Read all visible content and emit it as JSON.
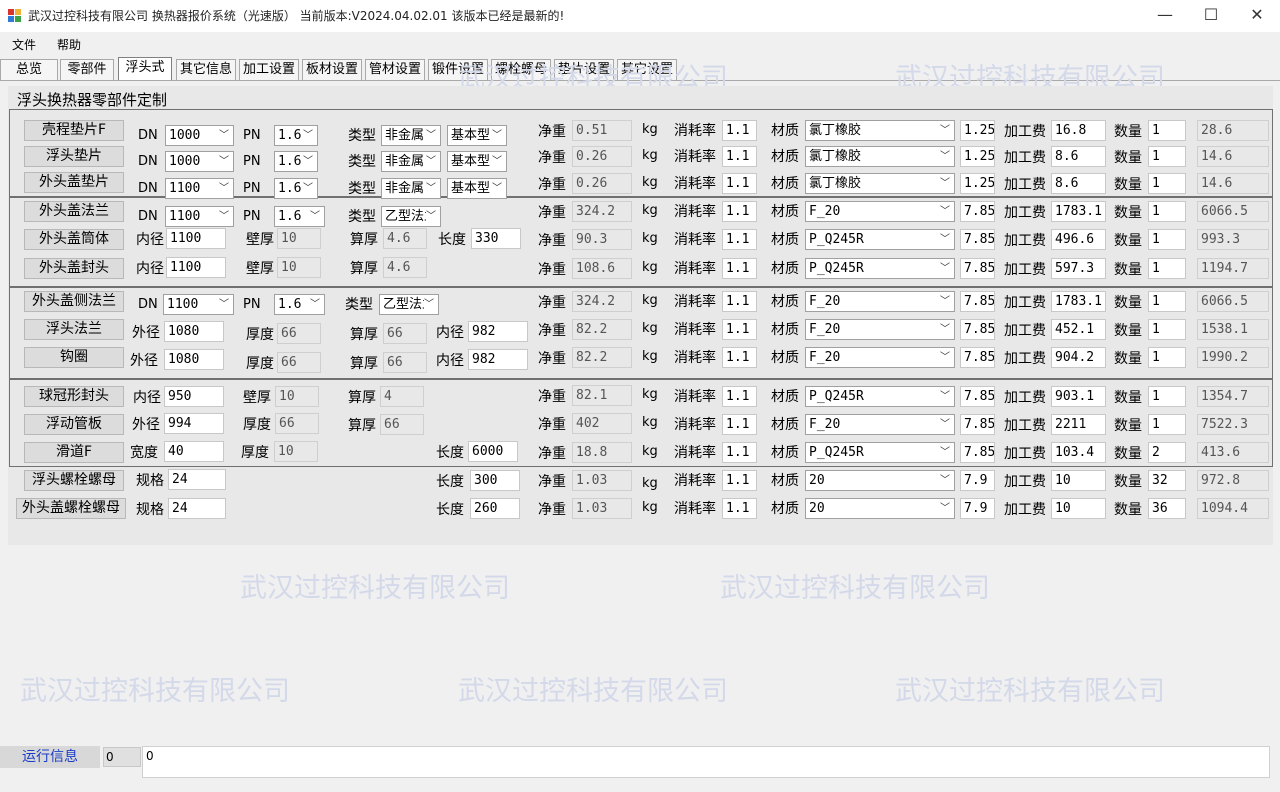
{
  "window": {
    "title": "武汉过控科技有限公司   换热器报价系统（光速版）  当前版本:V2024.04.02.01     该版本已经是最新的!",
    "minimize": "—",
    "maximize": "☐",
    "close": "✕"
  },
  "menu": {
    "file": "文件",
    "help": "帮助"
  },
  "tabs": [
    "总览",
    "零部件",
    "浮头式",
    "其它信息",
    "加工设置",
    "板材设置",
    "管材设置",
    "锻件设置",
    "螺栓螺母",
    "垫片设置",
    "其它设置"
  ],
  "panel": {
    "title": "浮头换热器零部件定制"
  },
  "labels": {
    "dn": "DN",
    "pn": "PN",
    "type": "类型",
    "net": "净重",
    "kg": "kg",
    "loss": "消耗率",
    "material": "材质",
    "fee": "加工费",
    "qty": "数量",
    "inner_d": "内径",
    "outer_d": "外径",
    "wall": "壁厚",
    "thick": "厚度",
    "calc_thick": "算厚",
    "length": "长度",
    "width": "宽度",
    "spec": "规格"
  },
  "watermark": "武汉过控科技有限公司",
  "rows": [
    {
      "name": "壳程垫片F",
      "dn": "1000",
      "pn": "1.6",
      "type1": "非金属",
      "type2": "基本型",
      "net": "0.51",
      "loss": "1.1",
      "mat": "氯丁橡胶",
      "den": "1.25",
      "fee": "16.8",
      "qty": "1",
      "total": "28.6"
    },
    {
      "name": "浮头垫片",
      "dn": "1000",
      "pn": "1.6",
      "type1": "非金属",
      "type2": "基本型",
      "net": "0.26",
      "loss": "1.1",
      "mat": "氯丁橡胶",
      "den": "1.25",
      "fee": "8.6",
      "qty": "1",
      "total": "14.6"
    },
    {
      "name": "外头盖垫片",
      "dn": "1100",
      "pn": "1.6",
      "type1": "非金属",
      "type2": "基本型",
      "net": "0.26",
      "loss": "1.1",
      "mat": "氯丁橡胶",
      "den": "1.25",
      "fee": "8.6",
      "qty": "1",
      "total": "14.6"
    },
    {
      "name": "外头盖法兰",
      "dn": "1100",
      "pn": "1.6",
      "type1": "乙型法兰",
      "net": "324.2",
      "loss": "1.1",
      "mat": "F_20",
      "den": "7.85",
      "fee": "1783.1",
      "qty": "1",
      "total": "6066.5"
    },
    {
      "name": "外头盖筒体",
      "inner": "1100",
      "wall": "10",
      "calc": "4.6",
      "length": "330",
      "net": "90.3",
      "loss": "1.1",
      "mat": "P_Q245R",
      "den": "7.85",
      "fee": "496.6",
      "qty": "1",
      "total": "993.3"
    },
    {
      "name": "外头盖封头",
      "inner": "1100",
      "wall": "10",
      "calc": "4.6",
      "net": "108.6",
      "loss": "1.1",
      "mat": "P_Q245R",
      "den": "7.85",
      "fee": "597.3",
      "qty": "1",
      "total": "1194.7"
    },
    {
      "name": "外头盖侧法兰",
      "dn": "1100",
      "pn": "1.6",
      "type1": "乙型法兰",
      "net": "324.2",
      "loss": "1.1",
      "mat": "F_20",
      "den": "7.85",
      "fee": "1783.1",
      "qty": "1",
      "total": "6066.5"
    },
    {
      "name": "浮头法兰",
      "outer": "1080",
      "thick": "66",
      "calc": "66",
      "inner": "982",
      "net": "82.2",
      "loss": "1.1",
      "mat": "F_20",
      "den": "7.85",
      "fee": "452.1",
      "qty": "1",
      "total": "1538.1"
    },
    {
      "name": "钩圈",
      "outer": "1080",
      "thick": "66",
      "calc": "66",
      "inner": "982",
      "net": "82.2",
      "loss": "1.1",
      "mat": "F_20",
      "den": "7.85",
      "fee": "904.2",
      "qty": "1",
      "total": "1990.2"
    },
    {
      "name": "球冠形封头",
      "inner": "950",
      "wall": "10",
      "calc": "4",
      "net": "82.1",
      "loss": "1.1",
      "mat": "P_Q245R",
      "den": "7.85",
      "fee": "903.1",
      "qty": "1",
      "total": "1354.7"
    },
    {
      "name": "浮动管板",
      "outer": "994",
      "thick": "66",
      "calc": "66",
      "net": "402",
      "loss": "1.1",
      "mat": "F_20",
      "den": "7.85",
      "fee": "2211",
      "qty": "1",
      "total": "7522.3"
    },
    {
      "name": "滑道F",
      "width": "40",
      "thick": "10",
      "length": "6000",
      "net": "18.8",
      "loss": "1.1",
      "mat": "P_Q245R",
      "den": "7.85",
      "fee": "103.4",
      "qty": "2",
      "total": "413.6"
    },
    {
      "name": "浮头螺栓螺母",
      "spec": "24",
      "length": "300",
      "net": "1.03",
      "loss": "1.1",
      "mat": "20",
      "den": "7.9",
      "fee": "10",
      "qty": "32",
      "total": "972.8"
    },
    {
      "name": "外头盖螺栓螺母",
      "spec": "24",
      "length": "260",
      "net": "1.03",
      "loss": "1.1",
      "mat": "20",
      "den": "7.9",
      "fee": "10",
      "qty": "36",
      "total": "1094.4"
    }
  ],
  "footer": {
    "label": "运行信息",
    "count": "0",
    "log": "0"
  }
}
